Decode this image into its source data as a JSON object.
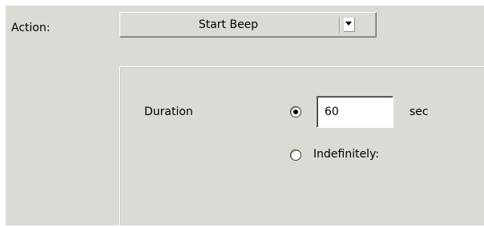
{
  "action": {
    "label": "Action:",
    "selected": "Start Beep"
  },
  "duration": {
    "label": "Duration",
    "value": "60",
    "unit": "sec",
    "selected": true
  },
  "indefinitely": {
    "label": "Indefinitely:",
    "selected": false
  },
  "icons": {
    "dropdown": "chevron-down-icon"
  },
  "colors": {
    "panel_background": "#dcdad5",
    "input_background": "#ffffff"
  }
}
